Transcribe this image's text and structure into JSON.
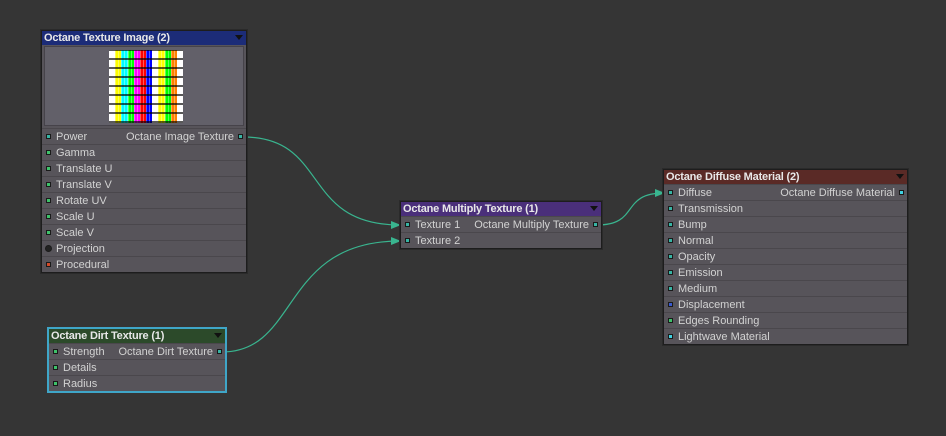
{
  "colors": {
    "canvas": "#353535",
    "wire": "#39b58f",
    "port_green": "#3ec26a",
    "port_teal": "#37b5a5",
    "port_cyan": "#3fd2e2",
    "port_dark": "#222222",
    "port_red": "#d24a2a",
    "port_blue": "#3a5ad0"
  },
  "nodes": {
    "texture_image": {
      "title": "Octane Texture Image (2)",
      "title_color": "#1c2c78",
      "output_label": "Octane Image Texture",
      "inputs": [
        {
          "label": "Power",
          "port": "teal"
        },
        {
          "label": "Gamma",
          "port": "green"
        },
        {
          "label": "Translate U",
          "port": "green"
        },
        {
          "label": "Translate V",
          "port": "green"
        },
        {
          "label": "Rotate UV",
          "port": "green"
        },
        {
          "label": "Scale U",
          "port": "green"
        },
        {
          "label": "Scale V",
          "port": "green"
        },
        {
          "label": "Projection",
          "port": "dark"
        },
        {
          "label": "Procedural",
          "port": "red"
        }
      ]
    },
    "multiply": {
      "title": "Octane Multiply Texture (1)",
      "title_color": "#4a2f7a",
      "output_label": "Octane Multiply Texture",
      "inputs": [
        {
          "label": "Texture 1",
          "port": "teal"
        },
        {
          "label": "Texture 2",
          "port": "teal"
        }
      ]
    },
    "dirt": {
      "title": "Octane Dirt Texture (1)",
      "title_color": "#2c4a2a",
      "output_label": "Octane Dirt Texture",
      "inputs": [
        {
          "label": "Strength",
          "port": "green"
        },
        {
          "label": "Details",
          "port": "green"
        },
        {
          "label": "Radius",
          "port": "green"
        }
      ]
    },
    "diffuse": {
      "title": "Octane Diffuse Material (2)",
      "title_color": "#5a2a26",
      "output_label": "Octane Diffuse Material",
      "inputs": [
        {
          "label": "Diffuse",
          "port": "teal"
        },
        {
          "label": "Transmission",
          "port": "teal"
        },
        {
          "label": "Bump",
          "port": "teal"
        },
        {
          "label": "Normal",
          "port": "teal"
        },
        {
          "label": "Opacity",
          "port": "teal"
        },
        {
          "label": "Emission",
          "port": "teal"
        },
        {
          "label": "Medium",
          "port": "teal"
        },
        {
          "label": "Displacement",
          "port": "blue"
        },
        {
          "label": "Edges Rounding",
          "port": "green"
        },
        {
          "label": "Lightwave Material",
          "port": "cyan"
        }
      ]
    }
  },
  "preview_stripes": [
    "#ffffff",
    "#ffff00",
    "#00ffff",
    "#00ff00",
    "#ff00ff",
    "#ff0000",
    "#0000ff",
    "#ffffff",
    "#ffff00",
    "#00ff00",
    "#ff8000",
    "#ffffff"
  ]
}
